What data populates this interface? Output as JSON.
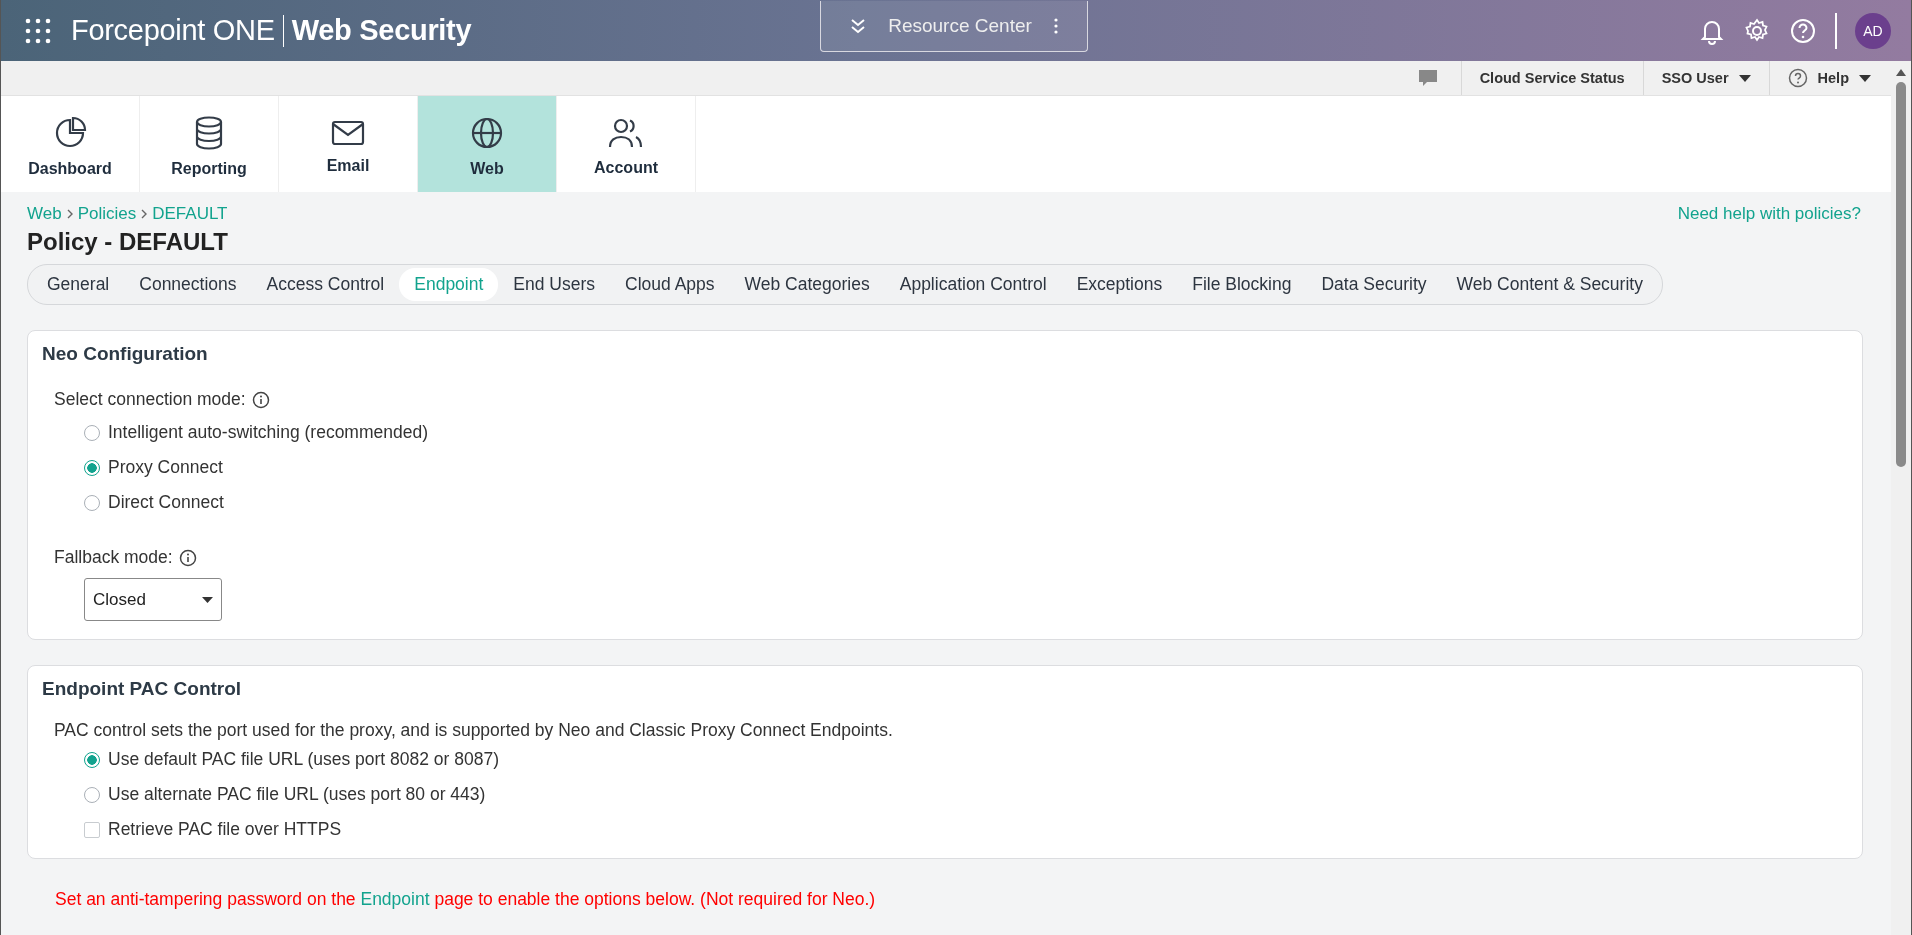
{
  "header": {
    "product": "Forcepoint ONE",
    "module": "Web Security",
    "resource_center": "Resource Center",
    "avatar": "AD"
  },
  "utility_bar": {
    "items": [
      {
        "label": "Cloud Service Status",
        "dropdown": false
      },
      {
        "label": "SSO User",
        "dropdown": true
      },
      {
        "label": "Help",
        "dropdown": true
      }
    ]
  },
  "nav": [
    {
      "label": "Dashboard",
      "selected": false
    },
    {
      "label": "Reporting",
      "selected": false
    },
    {
      "label": "Email",
      "selected": false
    },
    {
      "label": "Web",
      "selected": true
    },
    {
      "label": "Account",
      "selected": false
    }
  ],
  "breadcrumb": [
    "Web",
    "Policies",
    "DEFAULT"
  ],
  "help_link": "Need help with policies?",
  "title": "Policy - DEFAULT",
  "tabs": [
    {
      "label": "General",
      "selected": false
    },
    {
      "label": "Connections",
      "selected": false
    },
    {
      "label": "Access Control",
      "selected": false
    },
    {
      "label": "Endpoint",
      "selected": true
    },
    {
      "label": "End Users",
      "selected": false
    },
    {
      "label": "Cloud Apps",
      "selected": false
    },
    {
      "label": "Web Categories",
      "selected": false
    },
    {
      "label": "Application Control",
      "selected": false
    },
    {
      "label": "Exceptions",
      "selected": false
    },
    {
      "label": "File Blocking",
      "selected": false
    },
    {
      "label": "Data Security",
      "selected": false
    },
    {
      "label": "Web Content & Security",
      "selected": false
    }
  ],
  "neo_configuration": {
    "title": "Neo Configuration",
    "mode_label": "Select connection mode:",
    "modes": [
      {
        "label": "Intelligent auto-switching (recommended)",
        "selected": false
      },
      {
        "label": "Proxy Connect",
        "selected": true
      },
      {
        "label": "Direct Connect",
        "selected": false
      }
    ],
    "fallback_label": "Fallback mode:",
    "fallback_value": "Closed"
  },
  "pac_control": {
    "title": "Endpoint PAC Control",
    "description": "PAC control sets the port used for the proxy, and is supported by Neo and Classic Proxy Connect Endpoints.",
    "options": [
      {
        "kind": "radio",
        "label": "Use default PAC file URL (uses port 8082 or 8087)",
        "selected": true
      },
      {
        "kind": "radio",
        "label": "Use alternate PAC file URL (uses port 80 or 443)",
        "selected": false
      },
      {
        "kind": "checkbox",
        "label": "Retrieve PAC file over HTTPS",
        "checked": false
      }
    ]
  },
  "warning": {
    "before": "Set an anti-tampering password on the ",
    "link": "Endpoint",
    "after": " page to enable the options below. (Not required for Neo.)"
  }
}
